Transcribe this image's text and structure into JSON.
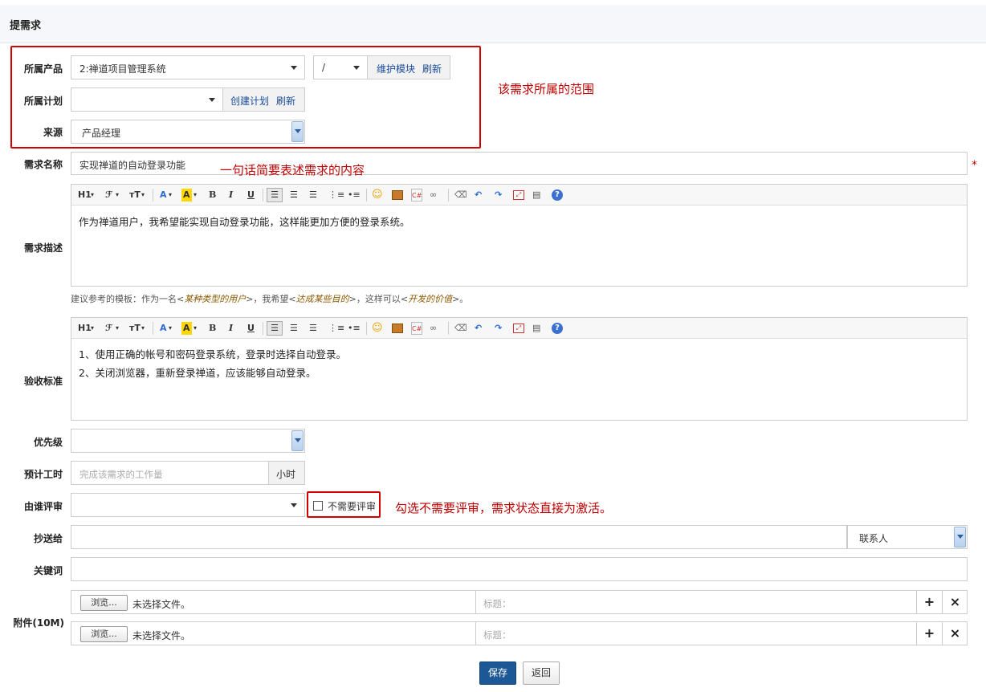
{
  "header": {
    "title": "提需求"
  },
  "labels": {
    "product": "所属产品",
    "plan": "所属计划",
    "source": "来源",
    "title": "需求名称",
    "spec": "需求描述",
    "verify": "验收标准",
    "priority": "优先级",
    "estimate": "预计工时",
    "reviewer": "由谁评审",
    "mailto": "抄送给",
    "keywords": "关键词",
    "files": "附件(10M)"
  },
  "product": {
    "value": "2:禅道项目管理系统",
    "module": "/",
    "maintain_link": "维护模块",
    "refresh_link": "刷新"
  },
  "plan": {
    "value": "",
    "create_link": "创建计划",
    "refresh_link": "刷新"
  },
  "source": {
    "value": "产品经理"
  },
  "title": {
    "value": "实现禅道的自动登录功能",
    "required": "*"
  },
  "toolbar": {
    "h1": "H1",
    "font": "ℱ",
    "size": "тT",
    "color": "A",
    "bg": "A",
    "bold": "B",
    "italic": "I",
    "underline": "U"
  },
  "spec": {
    "content": "作为禅道用户，我希望能实现自动登录功能，这样能更加方便的登录系统。"
  },
  "hint": {
    "prefix": "建议参考的模板：作为一名<",
    "role": "某种类型的用户",
    "mid1": ">，我希望<",
    "goal": "达成某些目的",
    "mid2": ">，这样可以<",
    "value": "开发的价值",
    "suffix": ">。"
  },
  "verify": {
    "line1": "1、使用正确的帐号和密码登录系统，登录时选择自动登录。",
    "line2": "2、关闭浏览器，重新登录禅道，应该能够自动登录。"
  },
  "estimate": {
    "placeholder": "完成该需求的工作量",
    "unit": "小时"
  },
  "review": {
    "checkbox_label": "不需要评审",
    "checked": false
  },
  "mailto": {
    "contacts": "联系人"
  },
  "files": {
    "rows": [
      {
        "browse": "浏览...",
        "status": "未选择文件。",
        "title_placeholder": "标题："
      },
      {
        "browse": "浏览...",
        "status": "未选择文件。",
        "title_placeholder": "标题："
      }
    ],
    "add": "+",
    "remove": "×"
  },
  "actions": {
    "save": "保存",
    "back": "返回"
  },
  "annotations": {
    "scope": "该需求所属的范围",
    "title": "一句话简要表述需求的内容",
    "review": "勾选不需要评审，需求状态直接为激活。"
  },
  "colors": {
    "annotation": "#c00000",
    "link": "#1a4b9b",
    "save_button": "#1c5796"
  }
}
